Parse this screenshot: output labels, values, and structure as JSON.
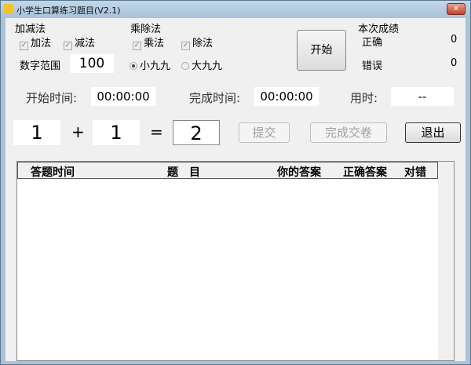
{
  "window": {
    "title": "小学生口算练习题目(V2.1)",
    "close": "✕"
  },
  "addsub": {
    "label": "加减法",
    "add": "加法",
    "sub": "减法"
  },
  "muldiv": {
    "label": "乘除法",
    "mul": "乘法",
    "div": "除法"
  },
  "range": {
    "label": "数字范围",
    "value": "100",
    "small": "小九九",
    "big": "大九九"
  },
  "start_button": "开始",
  "score": {
    "label": "本次成绩",
    "correct_label": "正确",
    "correct": "0",
    "wrong_label": "错误",
    "wrong": "0"
  },
  "times": {
    "start_label": "开始时间:",
    "start": "00:00:00",
    "end_label": "完成时间:",
    "end": "00:00:00",
    "used_label": "用时:",
    "used": "--"
  },
  "equation": {
    "a": "1",
    "op": "+",
    "b": "1",
    "eq": "=",
    "answer": "2"
  },
  "buttons": {
    "submit": "提交",
    "finish": "完成交卷",
    "exit": "退出"
  },
  "list": {
    "columns": [
      "答题时间",
      "题　目",
      "你的答案",
      "正确答案",
      "对错"
    ]
  }
}
